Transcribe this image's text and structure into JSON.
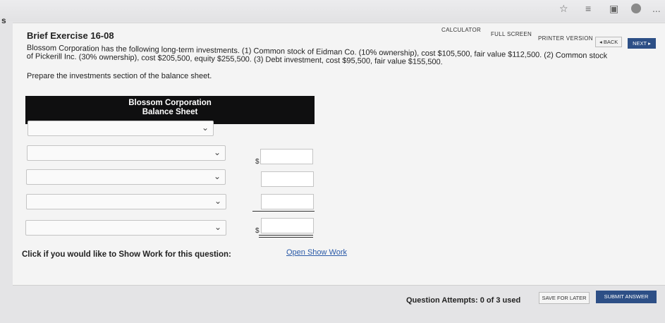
{
  "browser": {
    "star_icon": "star-outline-icon",
    "favorites_icon": "favorites-list-icon",
    "collections_icon": "collections-icon",
    "profile_icon": "profile-avatar-icon",
    "menu_label": "...",
    "corner_mark": "s"
  },
  "toolbar": {
    "calculator": "CALCULATOR",
    "full_screen": "FULL SCREEN",
    "printer_version": "PRINTER VERSION",
    "back": "◂ BACK",
    "next": "NEXT ▸"
  },
  "exercise": {
    "title": "Brief Exercise 16-08",
    "problem_line1": "Blossom Corporation has the following long-term investments. (1) Common stock of Eidman Co. (10% ownership), cost $105,500, fair value $112,500. (2) Common stock",
    "problem_line2": "of Pickerill Inc. (30% ownership), cost $205,500, equity $255,500. (3) Debt investment, cost $95,500, fair value $155,500.",
    "instruction": "Prepare the investments section of the balance sheet."
  },
  "balance_sheet": {
    "company": "Blossom Corporation",
    "statement": "Balance Sheet",
    "currency_symbol": "$",
    "rows": [
      {
        "select_value": "",
        "amount": ""
      },
      {
        "select_value": "",
        "amount": ""
      },
      {
        "select_value": "",
        "amount": ""
      },
      {
        "select_value": "",
        "amount": ""
      },
      {
        "select_value": "",
        "amount": ""
      }
    ]
  },
  "show_work": {
    "label": "Click if you would like to Show Work for this question:",
    "link": "Open Show Work"
  },
  "footer": {
    "attempts": "Question Attempts: 0 of 3 used",
    "save": "SAVE FOR LATER",
    "submit": "SUBMIT ANSWER"
  }
}
